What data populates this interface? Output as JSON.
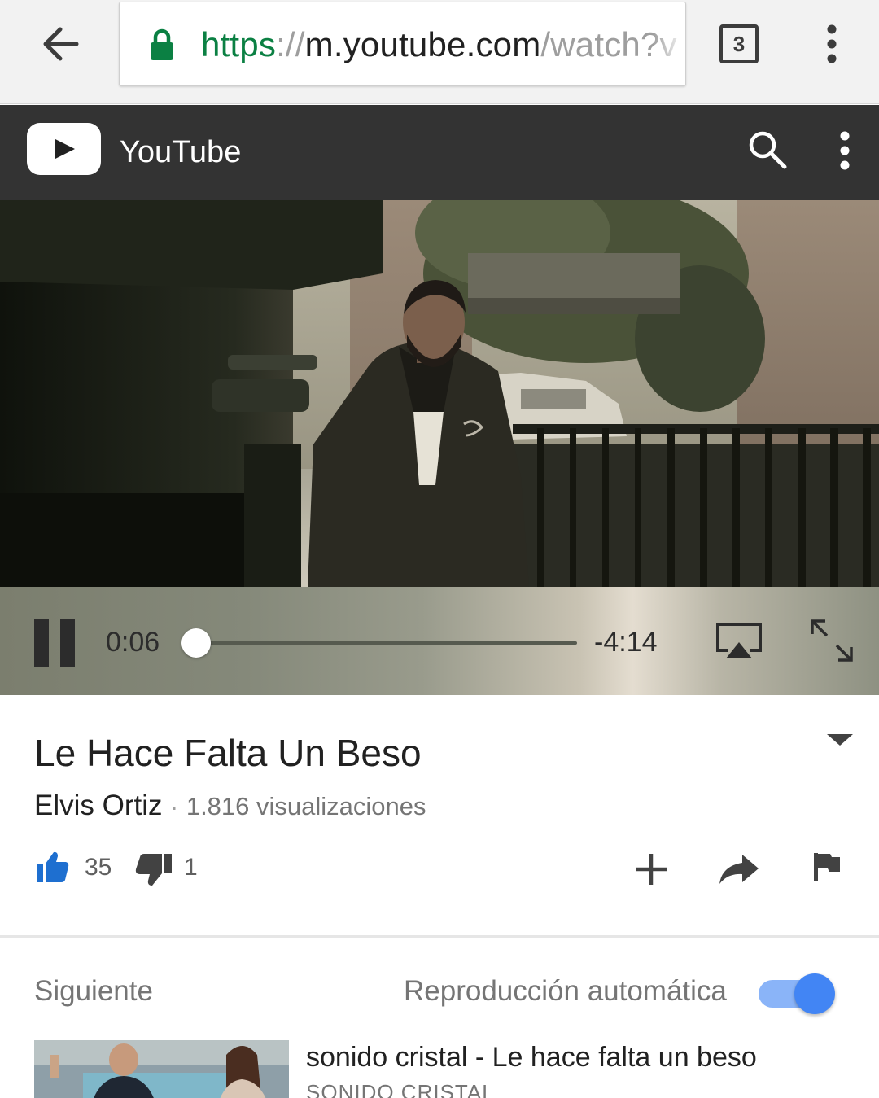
{
  "browser": {
    "url_scheme": "https",
    "url_separator": "://",
    "url_host": "m.youtube.com",
    "url_path": "/watch?v",
    "tab_count": "3"
  },
  "header": {
    "app_title": "YouTube",
    "icons": [
      "youtube-play-icon",
      "search-icon",
      "more-vert-icon"
    ]
  },
  "player": {
    "current_time": "0:06",
    "remaining_time": "-4:14",
    "progress_fraction": 0.024,
    "state": "playing",
    "icons": [
      "pause-icon",
      "airplay-icon",
      "fullscreen-icon"
    ]
  },
  "video": {
    "title": "Le Hace Falta Un Beso",
    "channel": "Elvis Ortiz",
    "separator": "·",
    "views": "1.816 visualizaciones",
    "likes": "35",
    "dislikes": "1",
    "icons": [
      "thumb-up-icon",
      "thumb-down-icon",
      "add-to-playlist-icon",
      "share-icon",
      "flag-icon",
      "expand-description-icon"
    ]
  },
  "up_next": {
    "label": "Siguiente",
    "autoplay_label": "Reproducción automática",
    "autoplay_on": true,
    "items": [
      {
        "title": "sonido cristal - Le hace falta un beso",
        "channel": "SONIDO CRISTAL"
      }
    ]
  },
  "colors": {
    "url_scheme_green": "#0b8043",
    "header_bg": "#333333",
    "like_blue": "#1e6fd0",
    "toggle_blue": "#4285f4"
  }
}
